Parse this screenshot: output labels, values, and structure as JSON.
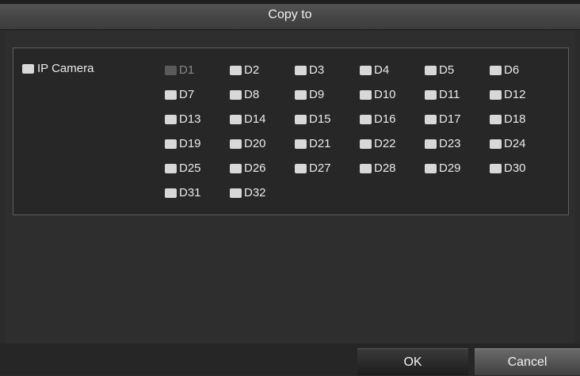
{
  "dialog": {
    "title": "Copy to",
    "ip_camera_label": "IP Camera",
    "channels": [
      {
        "label": "D1",
        "disabled": true
      },
      {
        "label": "D2"
      },
      {
        "label": "D3"
      },
      {
        "label": "D4"
      },
      {
        "label": "D5"
      },
      {
        "label": "D6"
      },
      {
        "label": "D7"
      },
      {
        "label": "D8"
      },
      {
        "label": "D9"
      },
      {
        "label": "D10"
      },
      {
        "label": "D11"
      },
      {
        "label": "D12"
      },
      {
        "label": "D13"
      },
      {
        "label": "D14"
      },
      {
        "label": "D15"
      },
      {
        "label": "D16"
      },
      {
        "label": "D17"
      },
      {
        "label": "D18"
      },
      {
        "label": "D19"
      },
      {
        "label": "D20"
      },
      {
        "label": "D21"
      },
      {
        "label": "D22"
      },
      {
        "label": "D23"
      },
      {
        "label": "D24"
      },
      {
        "label": "D25"
      },
      {
        "label": "D26"
      },
      {
        "label": "D27"
      },
      {
        "label": "D28"
      },
      {
        "label": "D29"
      },
      {
        "label": "D30"
      },
      {
        "label": "D31"
      },
      {
        "label": "D32"
      }
    ],
    "ok_label": "OK",
    "cancel_label": "Cancel"
  }
}
